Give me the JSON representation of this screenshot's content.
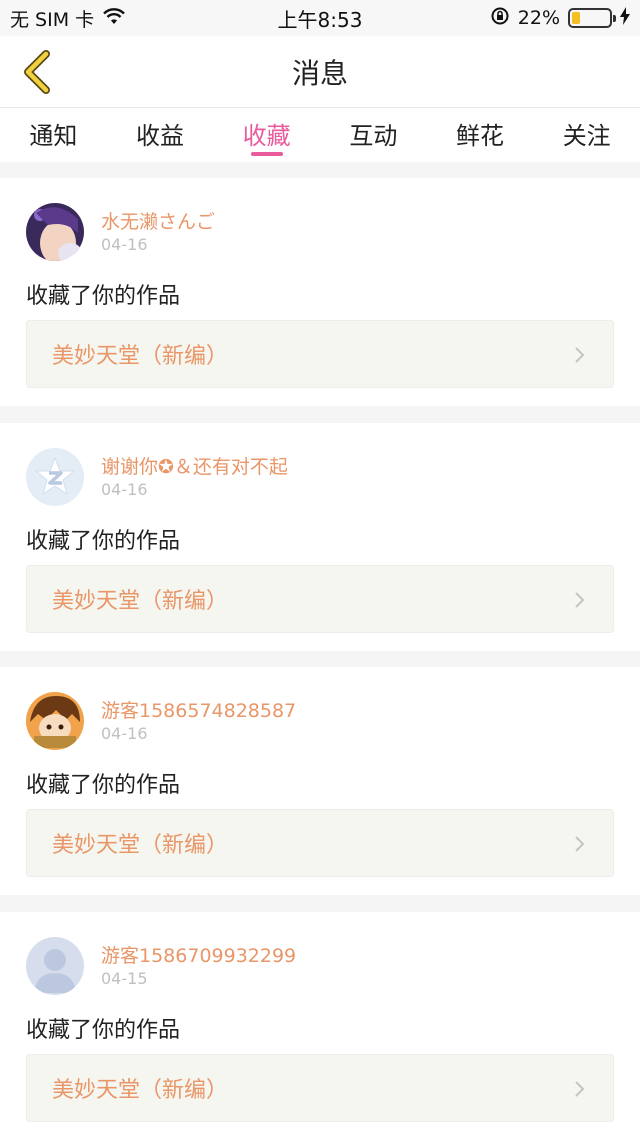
{
  "status_bar": {
    "carrier": "无 SIM 卡",
    "time": "上午8:53",
    "battery": "22%",
    "battery_level": 0.22
  },
  "header": {
    "title": "消息"
  },
  "tabs": [
    {
      "label": "通知",
      "active": false
    },
    {
      "label": "收益",
      "active": false
    },
    {
      "label": "收藏",
      "active": true
    },
    {
      "label": "互动",
      "active": false
    },
    {
      "label": "鲜花",
      "active": false
    },
    {
      "label": "关注",
      "active": false
    }
  ],
  "colors": {
    "accent": "#e95b9c",
    "username": "#e99668",
    "date": "#c0c0c0"
  },
  "messages": [
    {
      "user": "水无濑さんご",
      "date": "04-16",
      "action": "收藏了你的作品",
      "work": "美妙天堂（新编）",
      "avatar": "anime-girl-avatar"
    },
    {
      "user": "谢谢你✪＆还有对不起",
      "date": "04-16",
      "action": "收藏了你的作品",
      "work": "美妙天堂（新编）",
      "avatar": "qq-default-avatar"
    },
    {
      "user": "游客1586574828587",
      "date": "04-16",
      "action": "收藏了你的作品",
      "work": "美妙天堂（新编）",
      "avatar": "anime-boy-avatar"
    },
    {
      "user": "游客1586709932299",
      "date": "04-15",
      "action": "收藏了你的作品",
      "work": "美妙天堂（新编）",
      "avatar": "default-person-avatar"
    }
  ]
}
